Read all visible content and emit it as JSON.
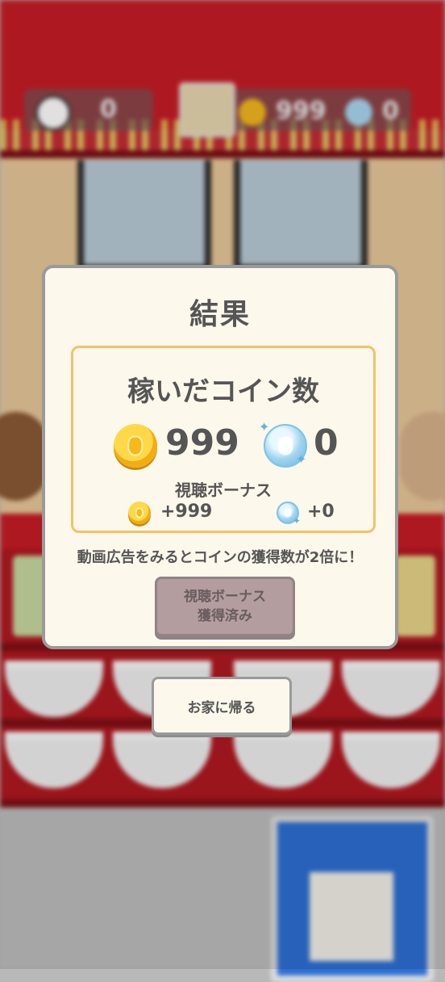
{
  "hud": {
    "time_value": "0",
    "coin_value": "999",
    "gem_value": "0"
  },
  "dialog": {
    "title": "結果",
    "earned_title": "稼いだコイン数",
    "coin_earned": "999",
    "gem_earned": "0",
    "bonus_label": "視聴ボーナス",
    "coin_bonus": "+999",
    "gem_bonus": "+0",
    "ad_message": "動画広告をみるとコインの獲得数が2倍に！",
    "bonus_button_line1": "視聴ボーナス",
    "bonus_button_line2": "獲得済み"
  },
  "home_button_label": "お家に帰る",
  "colors": {
    "accent_red": "#c71c26",
    "dialog_bg": "#fdf8ec",
    "box_border": "#f0c36a",
    "disabled_button": "#b39d9f"
  },
  "icons": [
    "clock-icon",
    "coin-icon",
    "gem-icon",
    "avatar-icon"
  ]
}
